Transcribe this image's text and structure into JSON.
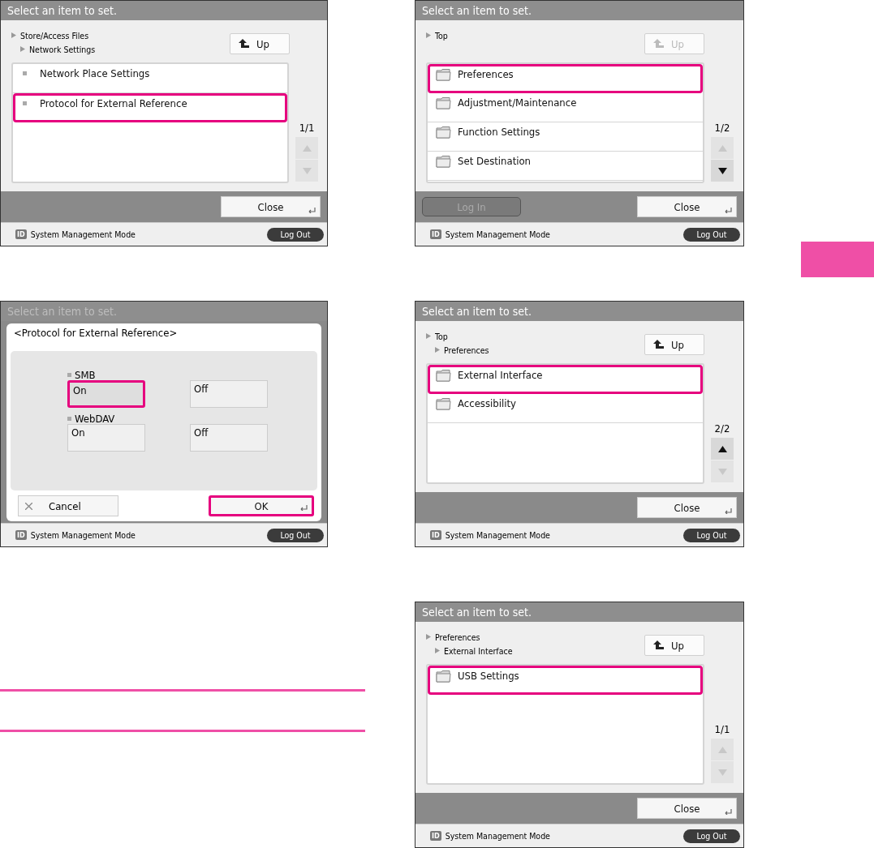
{
  "screens": [
    {
      "kind": "list",
      "title": "Select an item to set.",
      "breadcrumb": [
        "Store/Access Files",
        "Network Settings"
      ],
      "up_button": {
        "label": "Up",
        "disabled": false
      },
      "items": [
        {
          "kind": "bullet",
          "label": "Network Place Settings",
          "highlighted": false
        },
        {
          "kind": "bullet",
          "label": "Protocol for External Reference",
          "highlighted": true
        }
      ],
      "page": "1/1",
      "scroll_up_disabled": true,
      "scroll_down_disabled": true,
      "close_button": "Close",
      "status": {
        "badge": "ID",
        "mode": "System Management Mode",
        "logout": "Log Out"
      }
    },
    {
      "kind": "list",
      "title": "Select an item to set.",
      "breadcrumb": [
        "Top"
      ],
      "up_button": {
        "label": "Up",
        "disabled": true
      },
      "items": [
        {
          "kind": "folder",
          "label": "Preferences",
          "highlighted": true
        },
        {
          "kind": "folder",
          "label": "Adjustment/Maintenance",
          "highlighted": false
        },
        {
          "kind": "folder",
          "label": "Function Settings",
          "highlighted": false
        },
        {
          "kind": "folder",
          "label": "Set Destination",
          "highlighted": false
        }
      ],
      "page": "1/2",
      "scroll_up_disabled": true,
      "scroll_down_disabled": false,
      "login_button": {
        "label": "Log In",
        "disabled": true
      },
      "close_button": "Close",
      "status": {
        "badge": "ID",
        "mode": "System Management Mode",
        "logout": "Log Out"
      }
    },
    {
      "kind": "dialog",
      "title": "Select an item to set.",
      "dialog": {
        "title": "<Protocol for External Reference>",
        "groups": [
          {
            "label": "SMB",
            "options": [
              {
                "label": "On",
                "selected": true,
                "highlighted": true
              },
              {
                "label": "Off",
                "selected": false,
                "highlighted": false
              }
            ]
          },
          {
            "label": "WebDAV",
            "options": [
              {
                "label": "On",
                "selected": false,
                "highlighted": false
              },
              {
                "label": "Off",
                "selected": false,
                "highlighted": false
              }
            ]
          }
        ],
        "cancel": {
          "label": "Cancel",
          "highlighted": false
        },
        "ok": {
          "label": "OK",
          "highlighted": true
        }
      },
      "status": {
        "badge": "ID",
        "mode": "System Management Mode",
        "logout": "Log Out"
      }
    },
    {
      "kind": "list",
      "title": "Select an item to set.",
      "breadcrumb": [
        "Top",
        "Preferences"
      ],
      "up_button": {
        "label": "Up",
        "disabled": false
      },
      "items": [
        {
          "kind": "folder",
          "label": "External Interface",
          "highlighted": true
        },
        {
          "kind": "folder",
          "label": "Accessibility",
          "highlighted": false
        }
      ],
      "page": "2/2",
      "scroll_up_disabled": false,
      "scroll_down_disabled": true,
      "close_button": "Close",
      "status": {
        "badge": "ID",
        "mode": "System Management Mode",
        "logout": "Log Out"
      }
    },
    {
      "kind": "list",
      "title": "Select an item to set.",
      "breadcrumb": [
        "Preferences",
        "External Interface"
      ],
      "up_button": {
        "label": "Up",
        "disabled": false
      },
      "items": [
        {
          "kind": "folder",
          "label": "USB Settings",
          "highlighted": true
        }
      ],
      "page": "1/1",
      "scroll_up_disabled": true,
      "scroll_down_disabled": true,
      "close_button": "Close",
      "status": {
        "badge": "ID",
        "mode": "System Management Mode",
        "logout": "Log Out"
      }
    }
  ]
}
